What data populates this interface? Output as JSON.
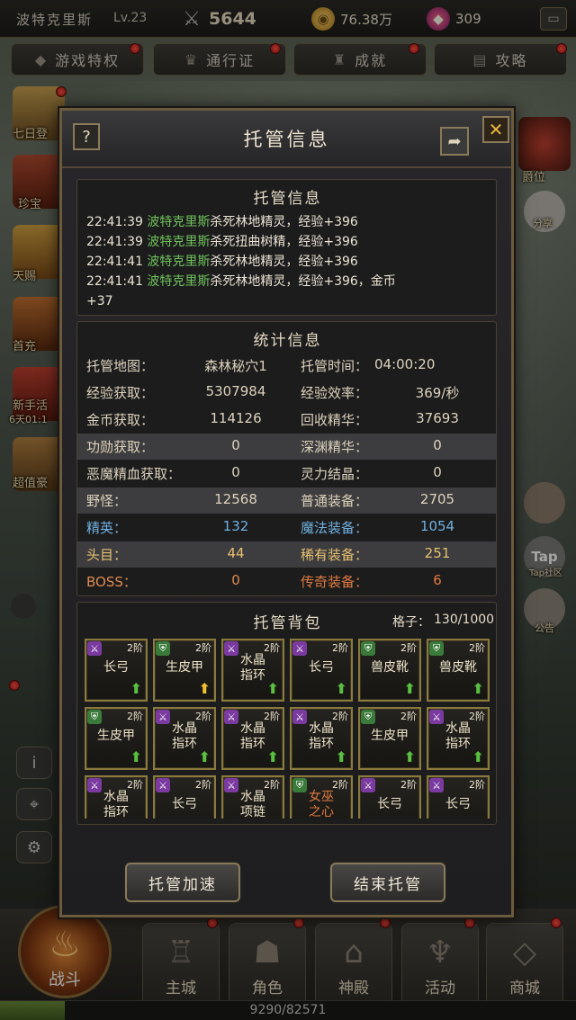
{
  "topbar": {
    "player_name": "波特克里斯",
    "level": "Lv.23",
    "power": "5644",
    "gold": "76.38万",
    "gems": "309"
  },
  "nav": [
    "游戏特权",
    "通行证",
    "成就",
    "攻略"
  ],
  "side_left": [
    "七日登",
    "珍宝",
    "天赐",
    "首充",
    "新手活",
    "6天01:1",
    "超值豪"
  ],
  "side_right": [
    "爵位",
    "分享",
    "Tap",
    "Tap社区",
    "公告"
  ],
  "bottom": {
    "battle": "战斗",
    "tabs": [
      "主城",
      "角色",
      "神殿",
      "活动",
      "商城"
    ],
    "xp_text": "9290/82571",
    "xp_progress": 0.1125
  },
  "dialog": {
    "title": "托管信息",
    "help": "?",
    "close": "✕",
    "log": {
      "title": "托管信息",
      "lines": [
        {
          "time": "22:41:39",
          "who": "波特克里斯",
          "text": "杀死林地精灵，经验+396"
        },
        {
          "time": "22:41:39",
          "who": "波特克里斯",
          "text": "杀死扭曲树精，经验+396"
        },
        {
          "time": "22:41:41",
          "who": "波特克里斯",
          "text": "杀死林地精灵，经验+396"
        },
        {
          "time": "22:41:41",
          "who": "波特克里斯",
          "text": "杀死林地精灵，经验+396，金币"
        }
      ],
      "overflow": "+37"
    },
    "stats": {
      "title": "统计信息",
      "rows": [
        {
          "k1": "托管地图：",
          "v1": "森林秘穴1",
          "k2": "托管时间：",
          "v2": "04:00:20"
        },
        {
          "k1": "经验获取：",
          "v1": "5307984",
          "k2": "经验效率：",
          "v2": "369/秒"
        },
        {
          "k1": "金币获取：",
          "v1": "114126",
          "k2": "回收精华：",
          "v2": "37693"
        },
        {
          "k1": "功勋获取：",
          "v1": "0",
          "k2": "深渊精华：",
          "v2": "0"
        },
        {
          "k1": "恶魔精血获取：",
          "v1": "0",
          "k2": "灵力结晶：",
          "v2": "0"
        },
        {
          "k1": "野怪：",
          "v1": "12568",
          "k2": "普通装备：",
          "v2": "2705"
        },
        {
          "k1": "精英：",
          "v1": "132",
          "k2": "魔法装备：",
          "v2": "1054"
        },
        {
          "k1": "头目：",
          "v1": "44",
          "k2": "稀有装备：",
          "v2": "251"
        },
        {
          "k1": "BOSS：",
          "v1": "0",
          "k2": "传奇装备：",
          "v2": "6"
        }
      ]
    },
    "bag": {
      "title": "托管背包",
      "slots_label": "格子：",
      "slots_value": "130/1000",
      "items": [
        {
          "name": "长弓",
          "tier": "2阶",
          "rarity": "magic",
          "arrow": "green"
        },
        {
          "name": "生皮甲",
          "tier": "2阶",
          "rarity": "normal",
          "arrow": "yellow"
        },
        {
          "name": "水晶指环",
          "tier": "2阶",
          "rarity": "magic",
          "arrow": "green"
        },
        {
          "name": "长弓",
          "tier": "2阶",
          "rarity": "magic",
          "arrow": "green"
        },
        {
          "name": "兽皮靴",
          "tier": "2阶",
          "rarity": "normal",
          "arrow": "green"
        },
        {
          "name": "兽皮靴",
          "tier": "2阶",
          "rarity": "normal",
          "arrow": "green"
        },
        {
          "name": "生皮甲",
          "tier": "2阶",
          "rarity": "normal",
          "arrow": "green"
        },
        {
          "name": "水晶指环",
          "tier": "2阶",
          "rarity": "magic",
          "arrow": "green"
        },
        {
          "name": "水晶指环",
          "tier": "2阶",
          "rarity": "magic",
          "arrow": "green"
        },
        {
          "name": "水晶指环",
          "tier": "2阶",
          "rarity": "magic",
          "arrow": "green"
        },
        {
          "name": "生皮甲",
          "tier": "2阶",
          "rarity": "normal",
          "arrow": "green"
        },
        {
          "name": "水晶指环",
          "tier": "2阶",
          "rarity": "magic",
          "arrow": "green"
        },
        {
          "name": "水晶指环",
          "tier": "2阶",
          "rarity": "magic",
          "arrow": "green"
        },
        {
          "name": "长弓",
          "tier": "2阶",
          "rarity": "magic",
          "arrow": "green"
        },
        {
          "name": "水晶项链",
          "tier": "2阶",
          "rarity": "magic",
          "arrow": "green"
        },
        {
          "name": "女巫之心",
          "tier": "2阶",
          "rarity": "legend",
          "arrow": "green"
        },
        {
          "name": "长弓",
          "tier": "2阶",
          "rarity": "magic",
          "arrow": "green"
        },
        {
          "name": "长弓",
          "tier": "2阶",
          "rarity": "magic",
          "arrow": "green"
        }
      ]
    },
    "buttons": {
      "speedup": "托管加速",
      "end": "结束托管"
    }
  },
  "colors": {
    "player_green": "#6fc25a",
    "elite_blue": "#6fb0e0",
    "boss_orange": "#e08a50",
    "rare_yellow": "#e8c070",
    "legend_orange": "#e07a40",
    "gold_border": "#8a7a3e"
  }
}
